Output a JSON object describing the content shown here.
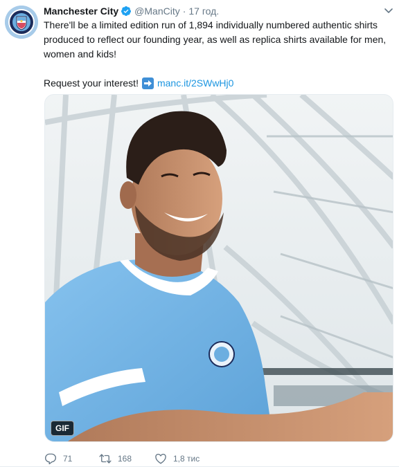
{
  "tweet": {
    "author_name": "Manchester City",
    "handle": "@ManCity",
    "separator": "·",
    "time": "17 год.",
    "text": "There'll be a limited edition run of 1,894 individually numbered authentic shirts produced to reflect our founding year, as well as replica shirts available for men, women and kids!",
    "request_text": "Request your interest!",
    "link_text": "manc.it/2SWwHj0",
    "media_badge": "GIF",
    "replies": "71",
    "retweets": "168",
    "likes": "1,8 тис"
  },
  "colors": {
    "link": "#1b95e0",
    "verified": "#1da1f2",
    "secondary_text": "#657786",
    "shirt": "#7ab8e6"
  },
  "icons": {
    "verified": "verified-badge-icon",
    "caret": "chevron-down-icon",
    "arrow": "right-arrow-emoji-icon",
    "reply": "reply-icon",
    "retweet": "retweet-icon",
    "like": "heart-icon"
  }
}
